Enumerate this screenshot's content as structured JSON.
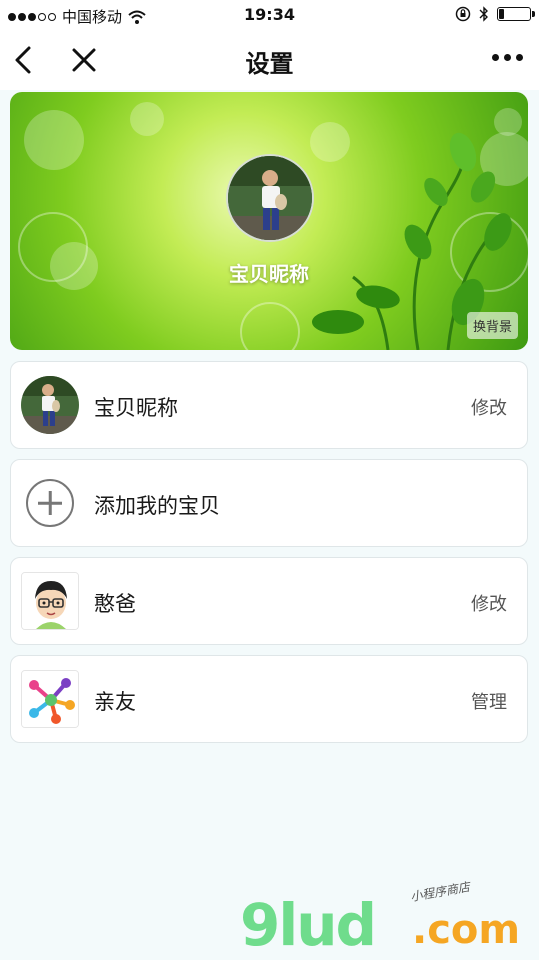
{
  "status_bar": {
    "carrier": "中国移动",
    "time": "19:34",
    "battery_level": 0.15
  },
  "nav": {
    "title": "设置",
    "back_icon": "chevron-left-icon",
    "close_icon": "close-icon",
    "more_icon": "more-dots-icon"
  },
  "banner": {
    "name": "宝贝昵称",
    "change_bg_label": "换背景"
  },
  "items": [
    {
      "label": "宝贝昵称",
      "action": "修改"
    },
    {
      "label": "添加我的宝贝",
      "action": ""
    },
    {
      "label": "憨爸",
      "action": "修改"
    },
    {
      "label": "亲友",
      "action": "管理"
    }
  ],
  "watermark": {
    "main": "9lud",
    "sub": ".com",
    "tag": "小程序商店"
  },
  "colors": {
    "accent_green": "#7fcc1f",
    "watermark_green": "#6fdc8c",
    "watermark_orange": "#f5a623"
  }
}
